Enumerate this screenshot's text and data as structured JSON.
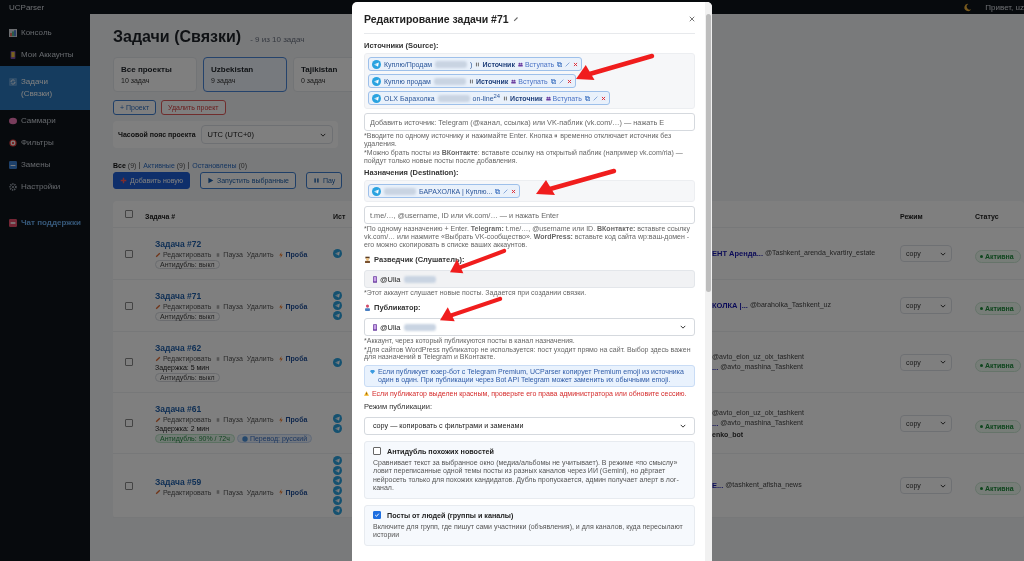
{
  "app": {
    "brand": "UCParser",
    "greeting": "Привет, uz"
  },
  "sidebar": {
    "items": [
      {
        "label": "Консоль",
        "selected": false
      },
      {
        "label": "Мои Аккаунты",
        "selected": false
      },
      {
        "label": "Задачи (Связки)",
        "selected": true
      },
      {
        "label": "Саммари",
        "selected": false
      },
      {
        "label": "Фильтры",
        "selected": false
      },
      {
        "label": "Замены",
        "selected": false
      },
      {
        "label": "Настройки",
        "selected": false
      }
    ],
    "support": "Чат поддержки"
  },
  "page": {
    "title": "Задачи (Связки)",
    "subtitle": "- 9 из 10 задач"
  },
  "projects": [
    {
      "name": "Все проекты",
      "count": "10 задач",
      "selected": false
    },
    {
      "name": "Uzbekistan",
      "count": "9 задач",
      "selected": true
    },
    {
      "name": "Tajikistan",
      "count": "0 задач",
      "selected": false
    }
  ],
  "project_buttons": [
    {
      "label": "+ Проект",
      "kind": "primary"
    },
    {
      "label": "Удалить проект",
      "kind": "danger"
    }
  ],
  "timezone": {
    "label": "Часовой пояс проекта",
    "value": "UTC (UTC+0)"
  },
  "filters": [
    {
      "label": "Все",
      "count": "(9)",
      "selected": true
    },
    {
      "label": "Активные",
      "count": "(9)",
      "selected": false
    },
    {
      "label": "Остановлены",
      "count": "(0)",
      "selected": false
    }
  ],
  "actions": [
    {
      "label": "Добавить новую",
      "kind": "add"
    },
    {
      "label": "Запустить выбранные",
      "kind": "run"
    },
    {
      "label": "Пау",
      "kind": "pause"
    }
  ],
  "table": {
    "select_all": {
      "checked": false
    },
    "columns": [
      "Задача #",
      "Ист",
      "Режим",
      "Статус"
    ],
    "rows": [
      {
        "title": "Задача #72",
        "checked": false,
        "actions": [
          {
            "label": "Редактировать",
            "kind": "edit"
          },
          {
            "label": "Пауза",
            "kind": "pause"
          },
          {
            "label": "Удалить",
            "kind": "delete"
          },
          {
            "label": "Проба",
            "kind": "test"
          }
        ],
        "badges": [
          {
            "text": "Антидубль: выкл",
            "kind": "off"
          }
        ],
        "sources": [
          {
            "kind": "telegram"
          }
        ],
        "channels": [
          {
            "name": "ЕНТ Аренда...",
            "handle": "@Tashkent_arenda_kvartiry_estate"
          }
        ],
        "mode": "copy",
        "status": {
          "text": "Активна",
          "kind": "active"
        }
      },
      {
        "title": "Задача #71",
        "checked": false,
        "actions": [
          {
            "label": "Редактировать",
            "kind": "edit"
          },
          {
            "label": "Пауза",
            "kind": "pause"
          },
          {
            "label": "Удалить",
            "kind": "delete"
          },
          {
            "label": "Проба",
            "kind": "test"
          }
        ],
        "badges": [
          {
            "text": "Антидубль: выкл",
            "kind": "off"
          }
        ],
        "sources": [
          {
            "kind": "telegram"
          },
          {
            "kind": "telegram"
          },
          {
            "kind": "telegram"
          }
        ],
        "channels": [
          {
            "name": "КОЛКА |...",
            "handle": "@baraholka_Tashkent_uz"
          }
        ],
        "mode": "copy",
        "status": {
          "text": "Активна",
          "kind": "active"
        }
      },
      {
        "title": "Задача #62",
        "checked": false,
        "actions": [
          {
            "label": "Редактировать",
            "kind": "edit"
          },
          {
            "label": "Пауза",
            "kind": "pause"
          },
          {
            "label": "Удалить",
            "kind": "delete"
          },
          {
            "label": "Проба",
            "kind": "test"
          }
        ],
        "delay": "Задержка: 5 мин",
        "badges": [
          {
            "text": "Антидубль: выкл",
            "kind": "off"
          }
        ],
        "sources": [
          {
            "kind": "telegram"
          }
        ],
        "channels": [
          {
            "handle": "@avto_elon_uz_olx_tashkent"
          },
          {
            "name": "...",
            "handle": "@avto_mashina_Tashkent"
          }
        ],
        "mode": "copy",
        "status": {
          "text": "Активна",
          "kind": "active"
        }
      },
      {
        "title": "Задача #61",
        "checked": false,
        "actions": [
          {
            "label": "Редактировать",
            "kind": "edit"
          },
          {
            "label": "Пауза",
            "kind": "pause"
          },
          {
            "label": "Удалить",
            "kind": "delete"
          },
          {
            "label": "Проба",
            "kind": "test"
          }
        ],
        "delay": "Задержка: 2 мин",
        "badges": [
          {
            "text": "Антидубль: 90% / 72ч",
            "kind": "on"
          },
          {
            "text": "Перевод: русский",
            "kind": "translate"
          }
        ],
        "sources": [
          {
            "kind": "telegram"
          },
          {
            "kind": "telegram"
          }
        ],
        "channels": [
          {
            "handle": "@avto_elon_uz_olx_tashkent"
          },
          {
            "name": "...",
            "handle": "@avto_mashina_Tashkent"
          },
          {
            "bot": "enko_bot"
          }
        ],
        "mode": "copy",
        "status": {
          "text": "Активна",
          "kind": "active"
        }
      },
      {
        "title": "Задача #59",
        "checked": false,
        "actions": [
          {
            "label": "Редактировать",
            "kind": "edit"
          },
          {
            "label": "Пауза",
            "kind": "pause"
          },
          {
            "label": "Удалить",
            "kind": "delete"
          },
          {
            "label": "Проба",
            "kind": "test"
          }
        ],
        "badges": [],
        "sources": [
          {
            "kind": "telegram"
          },
          {
            "kind": "telegram"
          },
          {
            "kind": "telegram"
          },
          {
            "kind": "telegram"
          },
          {
            "kind": "telegram"
          },
          {
            "kind": "telegram"
          }
        ],
        "channels": [
          {
            "name": "Е...",
            "handle": "@tashkent_afisha_news"
          }
        ],
        "mode": "copy",
        "status": {
          "text": "Активна",
          "kind": "active"
        }
      }
    ]
  },
  "modal": {
    "title": "Редактирование задачи #71",
    "sources": {
      "label": "Источники (Source):",
      "marked": true,
      "chips": [
        {
          "prefix": "Куплю/Продам",
          "suffix": ")",
          "status": "Источник",
          "join": "Вступать"
        },
        {
          "prefix": "Куплю продам",
          "status": "Источник",
          "join": "Вступать"
        },
        {
          "prefix": "OLX Барахолка",
          "suffix": "on-line$^{24}$",
          "status": "Источник",
          "join": "Вступать"
        }
      ],
      "placeholder": "Добавить источник: Telegram (@канал, ссылка) или VK-паблик (vk.com/…) — нажать E",
      "hints": [
        "*Вводите по одному источнику и нажимайте Enter. Кнопка ⏸ временно отключает источник без удаления.",
        "*Можно брать посты из **ВКонтакте**: вставьте ссылку на открытый паблик (например vk.com/ria) — пойдут только новые посты после добавления."
      ]
    },
    "destinations": {
      "label": "Назначения (Destination):",
      "marked": true,
      "chips": [
        {
          "suffix": "БАРАХОЛКА | Куплю..."
        }
      ],
      "placeholder": "t.me/…, @username, ID или vk.com/… — и нажать Enter",
      "hints": [
        "*По одному назначению + Enter. **Telegram:** t.me/…, @username или ID. **ВКонтакте:** вставьте ссылку vk.com/… или нажмите «Выбрать VK-сообщество». **WordPress:** вставьте код сайта wp:ваш-домен - его можно скопировать в списке ваших аккаунтов."
      ]
    },
    "listener": {
      "label": "Разведчик (Слушатель):",
      "value": "@Ulia",
      "marked": true,
      "hints": [
        "*Этот аккаунт слушает новые посты. Задается при создании связки."
      ]
    },
    "publisher": {
      "label": "Публикатор:",
      "value": "@Ulia",
      "marked": true,
      "hints": [
        "*Аккаунт, через который публикуются посты в канал назначения.",
        "*Для сайтов WordPress публикатор не используется: пост уходит прямо на сайт. Выбор здесь важен для назначений в Telegram и ВКонтакте."
      ]
    },
    "info": "Если публикует юзер-бот с Telegram Premium, UCParser копирует Premium emoji из источника один в один. При публикации через Bot API Telegram может заменить их обычными emoji.",
    "warning": "Если публикатор выделен красным, проверьте его права администратора или обновите сессию.",
    "mode": {
      "label": "Режим публикации:",
      "value": "copy — копировать с фильтрами и заменами"
    },
    "options": [
      {
        "title": "Антидубль похожих новостей",
        "checked": false,
        "description": "Сравнивает текст за выбранное окно (медиа/альбомы не учитывает). В режиме «по смыслу» ловит переписанные одной темы посты из разных каналов через ИИ (Gemini), но дёргает нейросеть только для похожих кандидатов. Дубль пропускается, админ получает алерт в лог-канал."
      },
      {
        "title": "Посты от людей (группы и каналы)",
        "checked": true,
        "description": "Включите для групп, где пишут сами участники (объявления), и для каналов, куда пересылают истории"
      }
    ]
  }
}
